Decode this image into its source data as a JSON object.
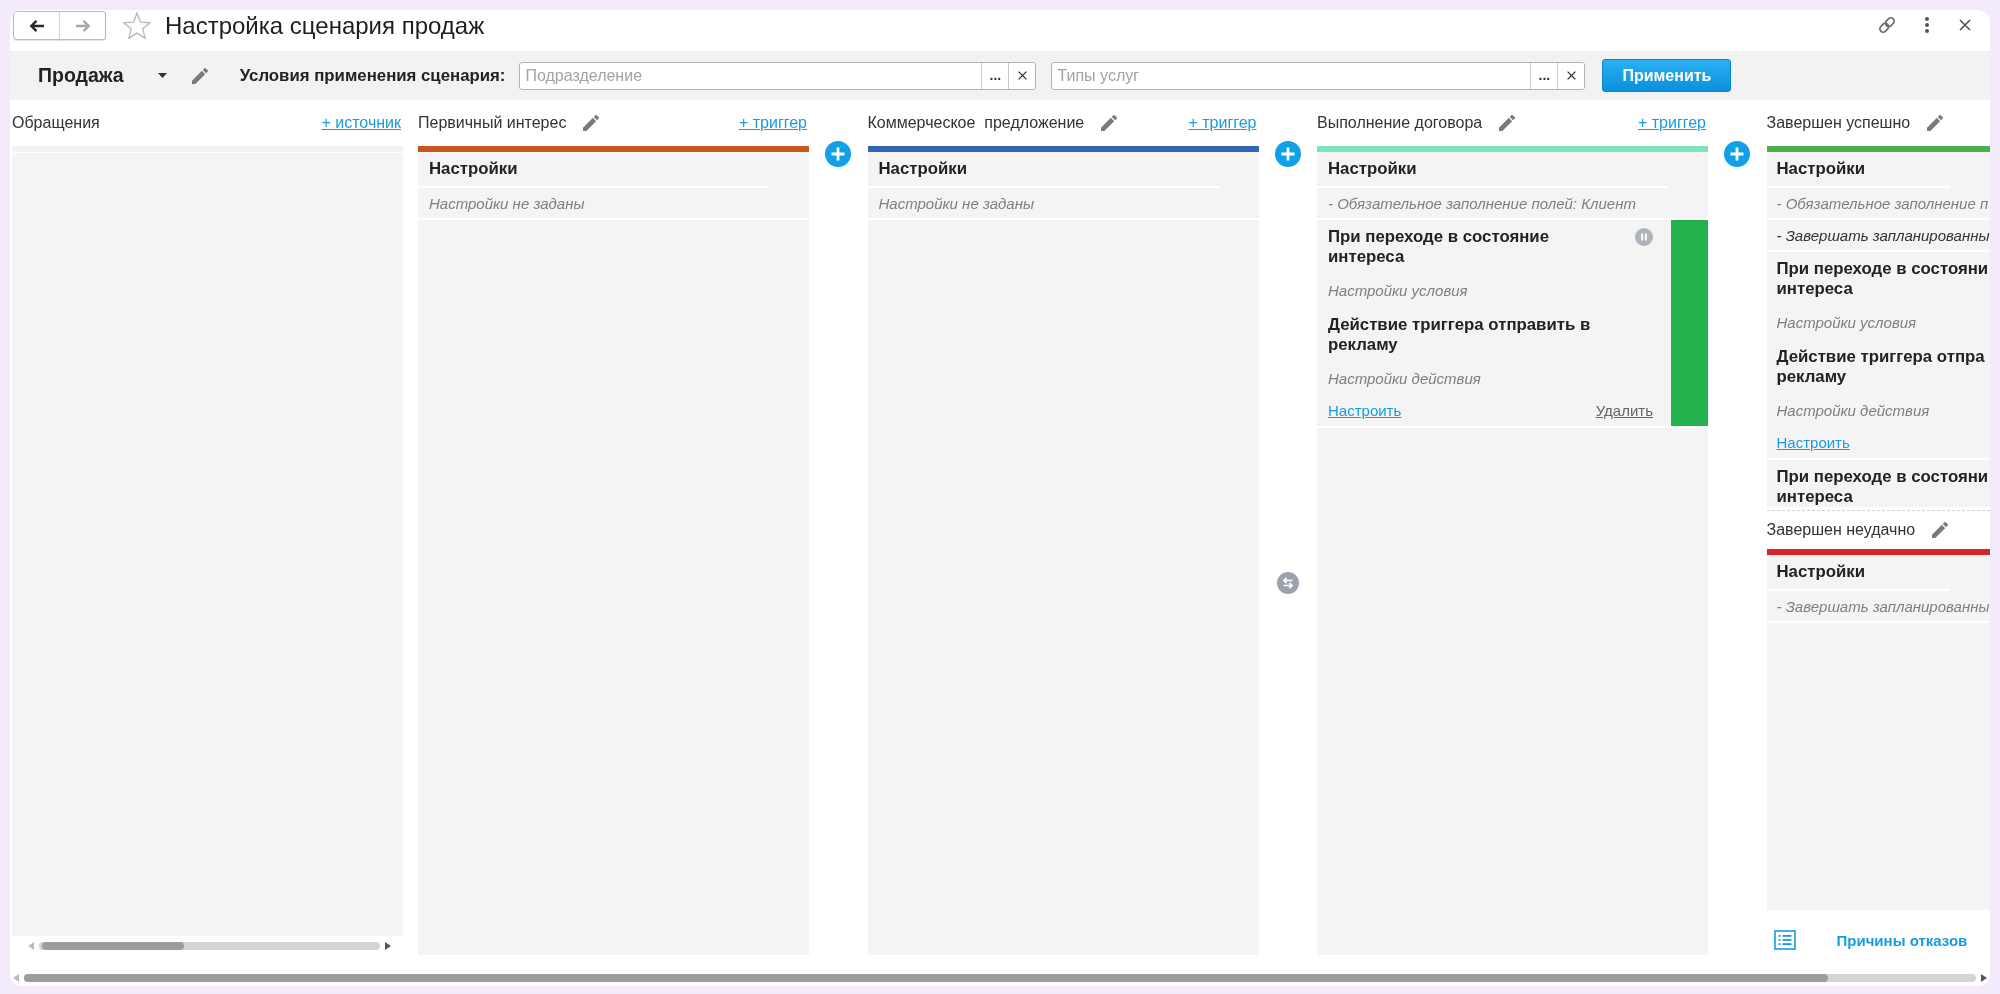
{
  "window": {
    "title": "Настройка сценария продаж",
    "favorite": false,
    "nav": [
      {
        "kind": "back",
        "disabled": false
      },
      {
        "kind": "forward",
        "disabled": true
      }
    ]
  },
  "toolbar": {
    "scenario": "Продажа",
    "conditions_label": "Условия применения сценария:",
    "fields": [
      {
        "placeholder": "Подразделение",
        "select_button": "..."
      },
      {
        "placeholder": "Типы услуг",
        "select_button": "..."
      }
    ],
    "apply_button": "Применить"
  },
  "columns": [
    {
      "kind": "source",
      "title": "Обращения",
      "add_link": "+ источник"
    },
    {
      "kind": "stage",
      "title": "Первичный интерес",
      "color": "#c9561a",
      "add_link": "+ триггер",
      "settings_title": "Настройки",
      "settings": [
        {
          "text": "Настройки не заданы",
          "muted": true
        }
      ]
    },
    {
      "kind": "stage",
      "connectors": [
        {
          "kind": "add"
        }
      ],
      "title": "Коммерческое  предложение",
      "color": "#3563b5",
      "add_link": "+ триггер",
      "settings_title": "Настройки",
      "settings": [
        {
          "text": "Настройки не заданы",
          "muted": true
        }
      ]
    },
    {
      "kind": "stage",
      "connectors": [
        {
          "kind": "add"
        },
        {
          "kind": "swap"
        }
      ],
      "title": "Выполнение договора",
      "color": "#7de3b9",
      "add_link": "+ триггер",
      "settings_title": "Настройки",
      "settings": [
        {
          "text": "- Обязательное заполнение полей: Клиент",
          "muted": true
        }
      ],
      "triggers": [
        {
          "title": "При переходе в состояние\nинтереса",
          "condition": "Настройки условия",
          "action_title": "Действие триггера отправить в\nрекламу",
          "action": "Настройки действия",
          "active": true,
          "links": [
            {
              "kind": "configure",
              "label": "Настроить"
            },
            {
              "kind": "delete",
              "label": "Удалить"
            }
          ]
        }
      ]
    },
    {
      "kind": "final_group",
      "connectors": [
        {
          "kind": "add"
        }
      ],
      "stages": [
        {
          "title": "Завершен успешно",
          "color": "#4cae4c",
          "settings_title": "Настройки",
          "settings": [
            {
              "text": "- Обязательное заполнение п",
              "muted": true
            },
            {
              "text": "- Завершать запланированны",
              "muted": false
            }
          ],
          "triggers": [
            {
              "title": "При переходе в состояни\nинтереса",
              "condition": "Настройки условия",
              "action_title": "Действие триггера отпра\nрекламу",
              "action": "Настройки действия",
              "active": false,
              "links": [
                {
                  "kind": "configure",
                  "label": "Настроить"
                }
              ]
            },
            {
              "title": "При переходе в состояни\nинтереса",
              "active": false
            }
          ]
        },
        {
          "title": "Завершен неудачно",
          "color": "#d8232a",
          "settings_title": "Настройки",
          "settings": [
            {
              "text": "- Завершать запланированны",
              "muted": true
            }
          ]
        }
      ],
      "footer_link": "Причины отказов"
    }
  ]
}
